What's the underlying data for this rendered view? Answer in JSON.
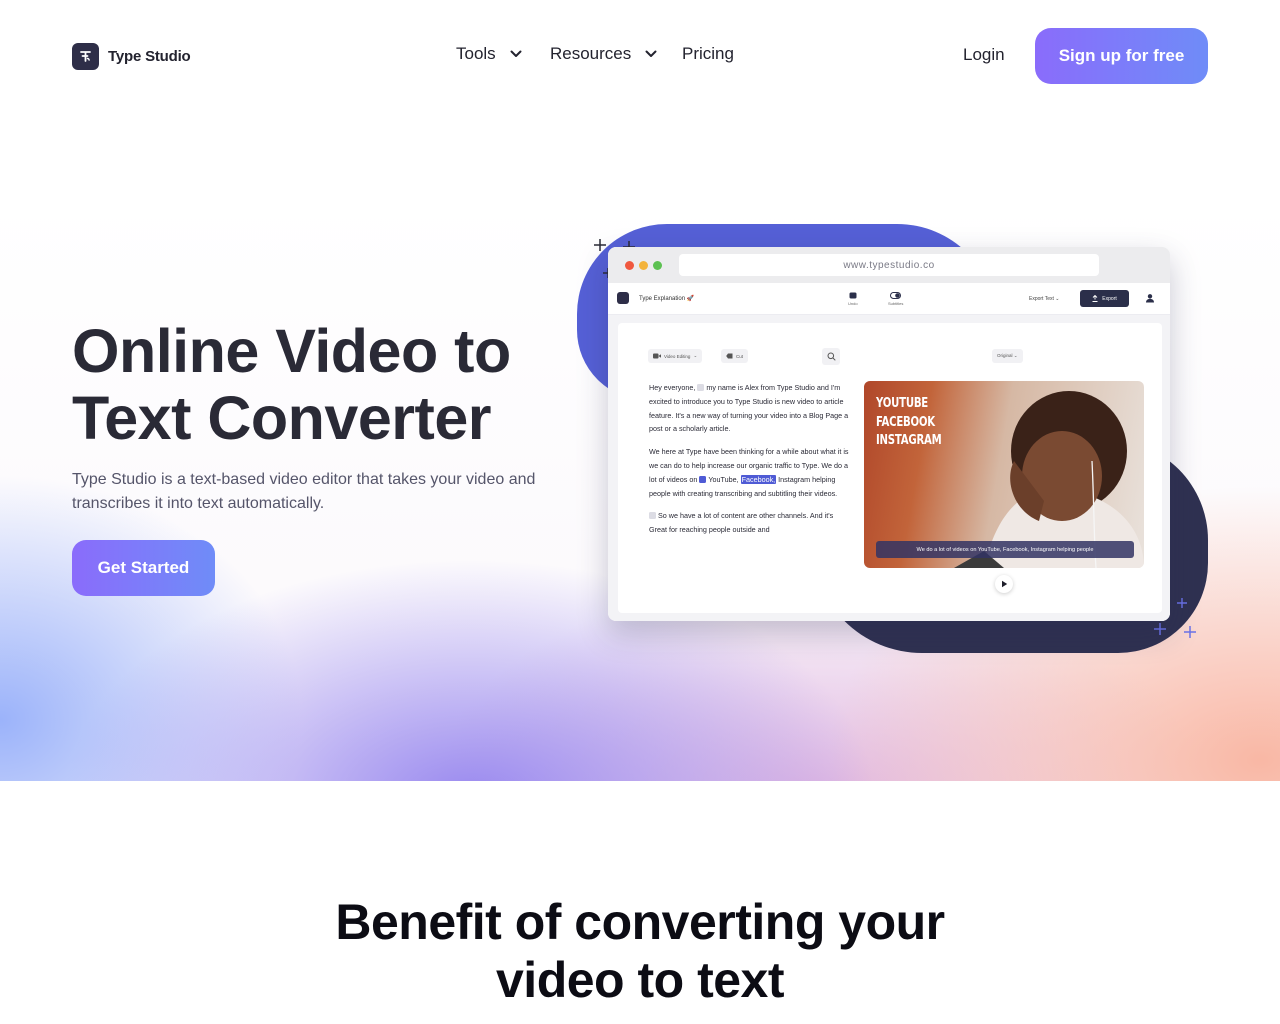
{
  "header": {
    "brand": "Type Studio",
    "nav": [
      {
        "label": "Tools",
        "has_dropdown": true
      },
      {
        "label": "Resources",
        "has_dropdown": true
      },
      {
        "label": "Pricing",
        "has_dropdown": false
      }
    ],
    "login_label": "Login",
    "signup_label": "Sign up for free"
  },
  "hero": {
    "title_line1": "Online Video to",
    "title_line2": "Text Converter",
    "description": "Type Studio is a text-based video editor that takes your video and transcribes it into text automatically.",
    "cta_label": "Get Started"
  },
  "mockup": {
    "url": "www.typestudio.co",
    "doc_title": "Type Explanation 🚀",
    "undo_label": "Undo",
    "subtitles_label": "Subtitles",
    "export_text_label": "Export Text ⌄",
    "export_label": "Export",
    "chip_video_editing": "Video Editing",
    "chip_cut": "Cut",
    "chip_original": "Original ⌄",
    "transcript": {
      "p1_a": "Hey everyone, ",
      "p1_b": "my name is Alex from Type Studio and I'm excited to introduce you to Type Studio is new video to article feature. It's a new way of turning your video into a Blog Page a post or a scholarly article.",
      "p2_a": "We here at Type have been thinking for a while about what it is we can do to help increase our organic traffic to Type. We do a lot of videos on ",
      "p2_youtube": "YouTube,",
      "p2_facebook": "Facebook,",
      "p2_instagram": "Instagram",
      "p2_b": " helping people with creating transcribing and subtitling their videos.",
      "p3_a": "So we have a lot of content are other channels. And it's Great for reaching people outside and"
    },
    "video_tags": [
      "YOUTUBE",
      "FACEBOOK",
      "INSTAGRAM"
    ],
    "video_caption": "We do a lot of videos on YouTube, Facebook, Instagram helping people"
  },
  "benefit": {
    "title_line1": "Benefit of converting your",
    "title_line2": "video to text"
  },
  "colors": {
    "accent_start": "#8a6cfb",
    "accent_end": "#6f8cf8",
    "navy": "#2f3151",
    "blue": "#5560d6"
  }
}
